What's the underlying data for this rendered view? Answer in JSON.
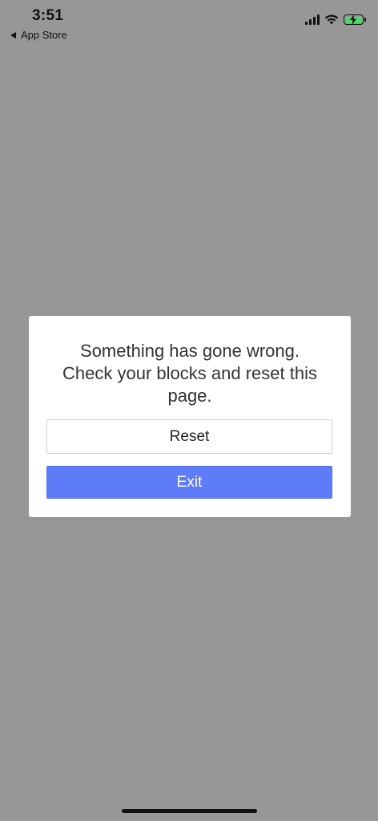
{
  "status_bar": {
    "time": "3:51",
    "back_label": "App Store",
    "battery_color": "#4cd964"
  },
  "modal": {
    "message_line1": "Something has gone wrong.",
    "message_line2": "Check your blocks and reset this",
    "message_line3": "page.",
    "reset_label": "Reset",
    "exit_label": "Exit",
    "exit_color": "#5f7cf8"
  }
}
